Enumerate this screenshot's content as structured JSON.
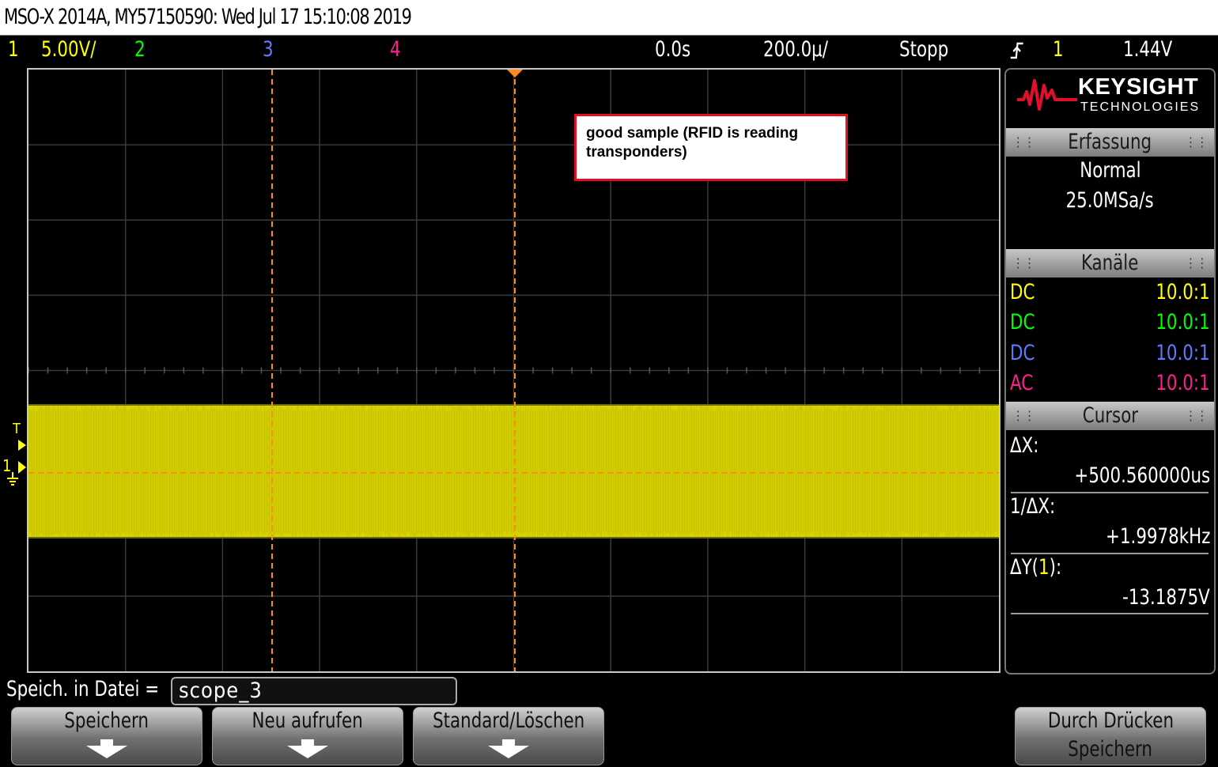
{
  "title": "MSO-X 2014A, MY57150590: Wed Jul 17 15:10:08 2019",
  "status": {
    "ch1_num": "1",
    "ch1_scale": "5.00V/",
    "ch2_num": "2",
    "ch3_num": "3",
    "ch4_num": "4",
    "time_delay": "0.0s",
    "time_scale": "200.0µ/",
    "run_state": "Stopp",
    "trigger_icon": "trigger-edge-icon",
    "trigger_source": "1",
    "trigger_level": "1.44V"
  },
  "annotation": "good sample (RFID is reading transponders)",
  "markers": {
    "trigger": "T",
    "ch1": "1"
  },
  "panel": {
    "logo_brand": "KEYSIGHT",
    "logo_sub": "TECHNOLOGIES",
    "acq_header": "Erfassung",
    "acq_mode": "Normal",
    "acq_rate": "25.0MSa/s",
    "channels_header": "Kanäle",
    "channels": [
      {
        "coupling": "DC",
        "probe": "10.0:1",
        "color": "#ffff00"
      },
      {
        "coupling": "DC",
        "probe": "10.0:1",
        "color": "#00ff00"
      },
      {
        "coupling": "DC",
        "probe": "10.0:1",
        "color": "#5e7bff"
      },
      {
        "coupling": "AC",
        "probe": "10.0:1",
        "color": "#ff1f8e"
      }
    ],
    "cursor_header": "Cursor",
    "dx_label": "ΔX:",
    "dx_value": "+500.560000us",
    "inv_dx_label": "1/ΔX:",
    "inv_dx_value": "+1.9978kHz",
    "dy_label_pre": "ΔY(",
    "dy_label_ch": "1",
    "dy_label_post": "):",
    "dy_value": "-13.1875V"
  },
  "save": {
    "label": "Speich. in Datei =",
    "filename": "scope_3"
  },
  "softkeys": [
    {
      "line1": "Speichern",
      "line2": ""
    },
    {
      "line1": "Neu aufrufen",
      "line2": ""
    },
    {
      "line1": "Standard/Löschen",
      "line2": ""
    },
    {
      "line1": "Durch Drücken",
      "line2": "Speichern"
    }
  ],
  "colors": {
    "ch1": "#ffff00",
    "ch2": "#00ff00",
    "ch3": "#5e7bff",
    "ch4": "#ff1f8e",
    "cursor": "#ff8c1a",
    "annotation_border": "#e01020",
    "trace": "#d8d400"
  }
}
